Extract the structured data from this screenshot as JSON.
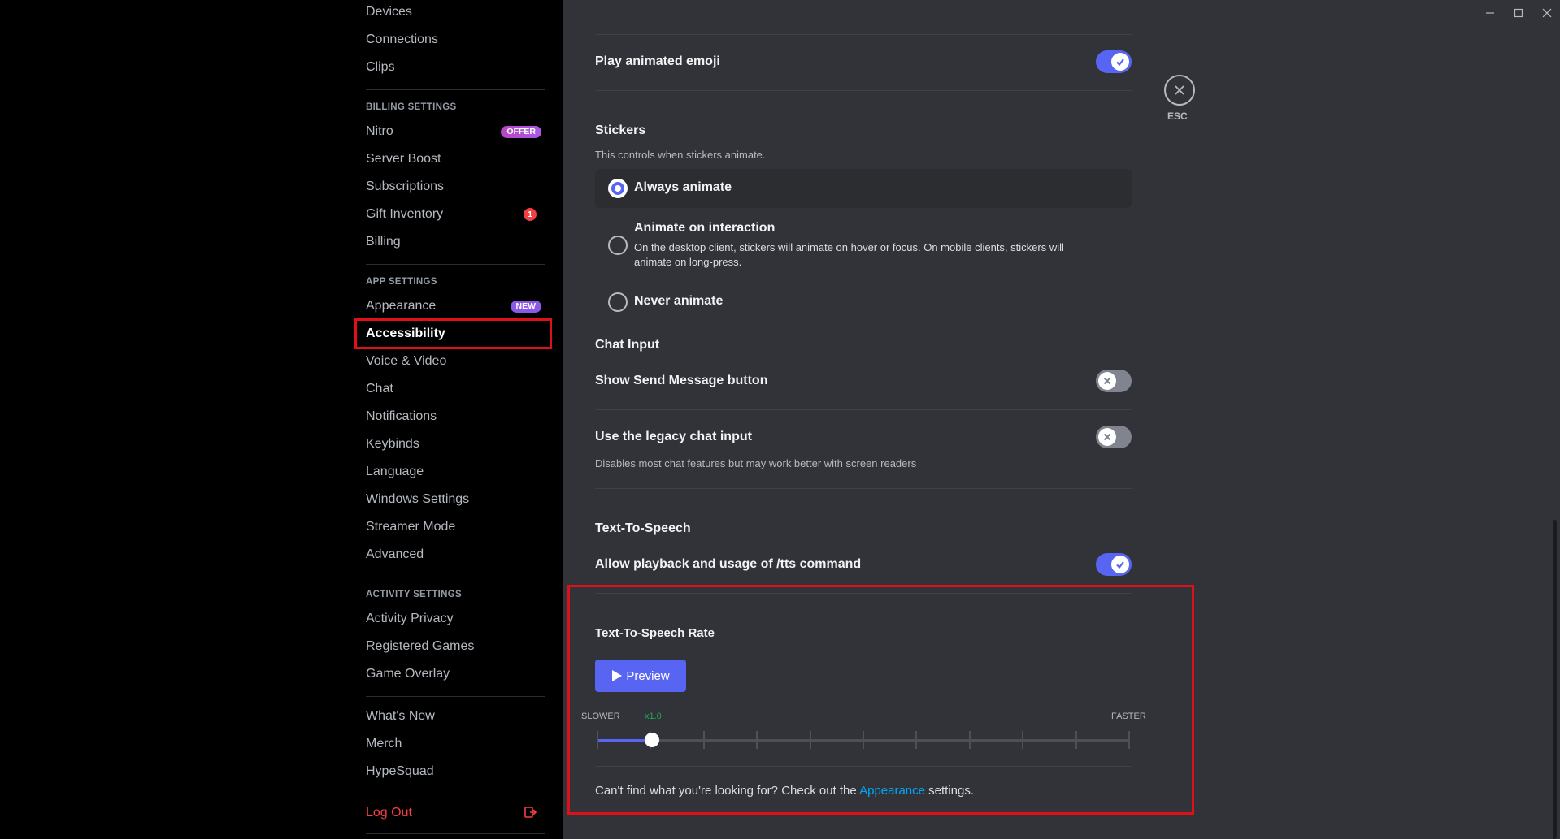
{
  "sidebar": {
    "top_items": [
      "Devices",
      "Connections",
      "Clips"
    ],
    "billing_header": "BILLING SETTINGS",
    "billing_items": [
      {
        "label": "Nitro",
        "badge": "OFFER"
      },
      {
        "label": "Server Boost"
      },
      {
        "label": "Subscriptions"
      },
      {
        "label": "Gift Inventory",
        "badge": "1"
      },
      {
        "label": "Billing"
      }
    ],
    "app_header": "APP SETTINGS",
    "app_items": [
      {
        "label": "Appearance",
        "badge": "NEW"
      },
      {
        "label": "Accessibility",
        "active": true
      },
      {
        "label": "Voice & Video"
      },
      {
        "label": "Chat"
      },
      {
        "label": "Notifications"
      },
      {
        "label": "Keybinds"
      },
      {
        "label": "Language"
      },
      {
        "label": "Windows Settings"
      },
      {
        "label": "Streamer Mode"
      },
      {
        "label": "Advanced"
      }
    ],
    "activity_header": "ACTIVITY SETTINGS",
    "activity_items": [
      "Activity Privacy",
      "Registered Games",
      "Game Overlay"
    ],
    "misc_items": [
      "What's New",
      "Merch",
      "HypeSquad"
    ],
    "logout": "Log Out"
  },
  "main": {
    "play_animated_emoji": {
      "label": "Play animated emoji",
      "enabled": true
    },
    "stickers": {
      "title": "Stickers",
      "description": "This controls when stickers animate.",
      "options": [
        {
          "label": "Always animate",
          "selected": true
        },
        {
          "label": "Animate on interaction",
          "description": "On the desktop client, stickers will animate on hover or focus. On mobile clients, stickers will animate on long-press."
        },
        {
          "label": "Never animate"
        }
      ]
    },
    "chat_input": {
      "title": "Chat Input",
      "send_button": {
        "label": "Show Send Message button",
        "enabled": false
      },
      "legacy": {
        "label": "Use the legacy chat input",
        "description": "Disables most chat features but may work better with screen readers",
        "enabled": false
      }
    },
    "tts": {
      "title": "Text-To-Speech",
      "allow": {
        "label": "Allow playback and usage of /tts command",
        "enabled": true
      },
      "rate_title": "Text-To-Speech Rate",
      "preview_label": "Preview",
      "slower_label": "SLOWER",
      "faster_label": "FASTER",
      "current_value_label": "x1.0",
      "tick_count": 11,
      "current_fraction": 0.104
    },
    "footer": {
      "prefix": "Can't find what you're looking for? Check out the ",
      "link": "Appearance",
      "suffix": " settings."
    }
  },
  "esc_label": "ESC",
  "colors": {
    "accent": "#5865f2",
    "highlight": "#e0101b",
    "link": "#00a8fc",
    "danger": "#f23f43"
  }
}
